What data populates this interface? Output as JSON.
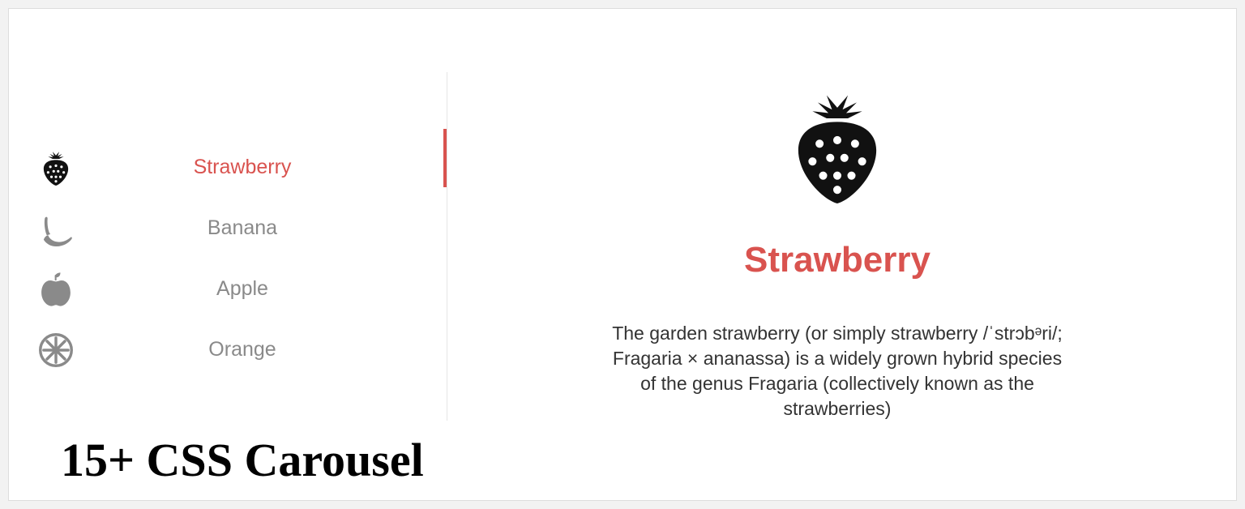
{
  "accent_color": "#d9534f",
  "sidebar": {
    "items": [
      {
        "label": "Strawberry",
        "icon": "strawberry-icon",
        "active": true
      },
      {
        "label": "Banana",
        "icon": "banana-icon",
        "active": false
      },
      {
        "label": "Apple",
        "icon": "apple-icon",
        "active": false
      },
      {
        "label": "Orange",
        "icon": "orange-icon",
        "active": false
      }
    ]
  },
  "detail": {
    "icon": "strawberry-icon",
    "title": "Strawberry",
    "description": "The garden strawberry (or simply strawberry /ˈstrɔbᵊri/; Fragaria × ananassa) is a widely grown hybrid species of the genus Fragaria (collectively known as the strawberries)"
  },
  "page_heading": "15+ CSS Carousel"
}
